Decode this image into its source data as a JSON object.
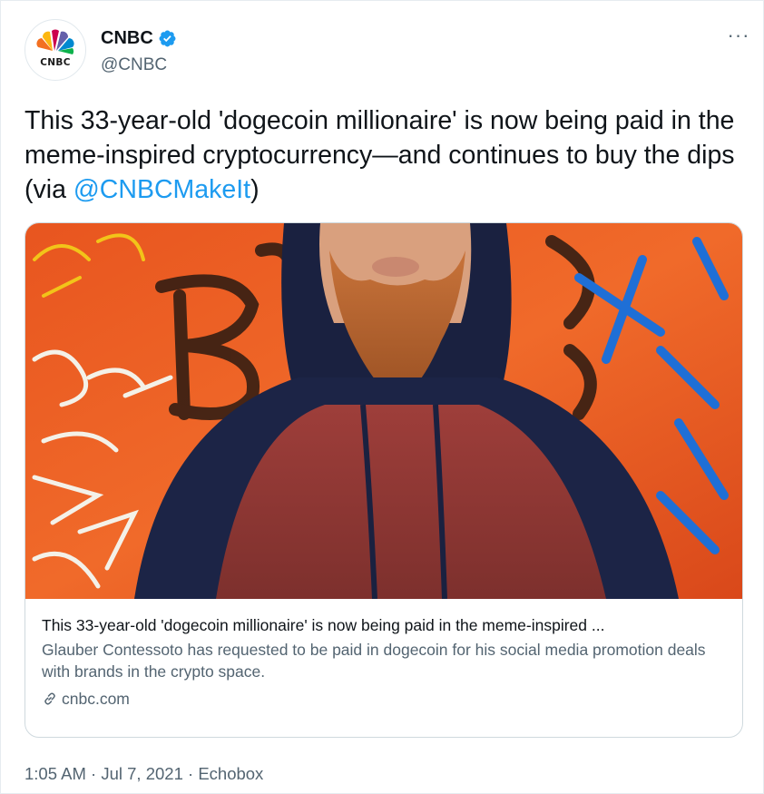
{
  "tweet": {
    "author": {
      "display_name": "CNBC",
      "handle": "@CNBC",
      "avatar_text": "CNBC",
      "verified": true,
      "avatar_icon": "nbc-peacock-logo"
    },
    "more_label": "···",
    "text_main": "This 33-year-old 'dogecoin millionaire' is now being paid in the meme-inspired cryptocurrency—and continues to buy the dips (via ",
    "mention": "@CNBCMakeIt",
    "text_end": ")",
    "card": {
      "title": "This 33-year-old 'dogecoin millionaire' is now being paid in the meme-inspired ...",
      "description": "Glauber Contessoto has requested to be paid in dogecoin for his social media promotion deals with brands in the crypto space.",
      "domain": "cnbc.com",
      "domain_icon": "link-icon"
    },
    "time": "1:05 AM",
    "date": "Jul 7, 2021",
    "source": "Echobox",
    "separator": " · "
  },
  "colors": {
    "text": "#0f1419",
    "secondary": "#536471",
    "link": "#1d9bf0",
    "verified": "#1d9bf0",
    "border": "#cfd9de"
  }
}
